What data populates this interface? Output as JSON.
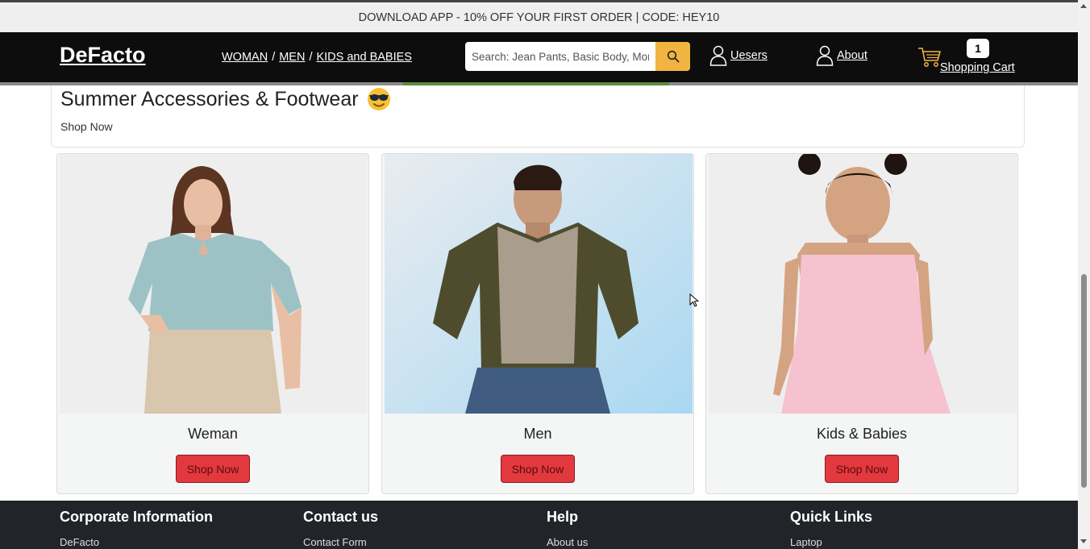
{
  "promo": {
    "text": "DOWNLOAD APP - 10% OFF YOUR FIRST ORDER | CODE: HEY10"
  },
  "header": {
    "logo": "DeFacto",
    "categories": [
      {
        "label": "WOMAN"
      },
      {
        "label": "MEN"
      },
      {
        "label": "KIDS and BABIES"
      }
    ],
    "category_separator": "/",
    "search_placeholder": "Search: Jean Pants, Basic Body, Mom Jeans",
    "users_label": "Uesers",
    "about_label": "About",
    "cart_label": "Shopping Cart",
    "cart_count": "1"
  },
  "banner": {
    "title": "Summer Accessories & Footwear",
    "emoji": "sunglasses-face",
    "shop_label": "Shop Now"
  },
  "cards": [
    {
      "title": "Weman",
      "button": "Shop Now"
    },
    {
      "title": "Men",
      "button": "Shop Now"
    },
    {
      "title": "Kids & Babies",
      "button": "Shop Now"
    }
  ],
  "footer": {
    "columns": [
      {
        "heading": "Corporate Information",
        "first_link": "DeFacto"
      },
      {
        "heading": "Contact us",
        "first_link": "Contact Form"
      },
      {
        "heading": "Help",
        "first_link": "About us"
      },
      {
        "heading": "Quick Links",
        "first_link": "Laptop"
      }
    ]
  },
  "colors": {
    "navbar": "#0d0d0d",
    "search_button": "#f2b441",
    "shop_button": "#e2393f",
    "footer": "#212529",
    "promo_bar": "#efefef"
  }
}
